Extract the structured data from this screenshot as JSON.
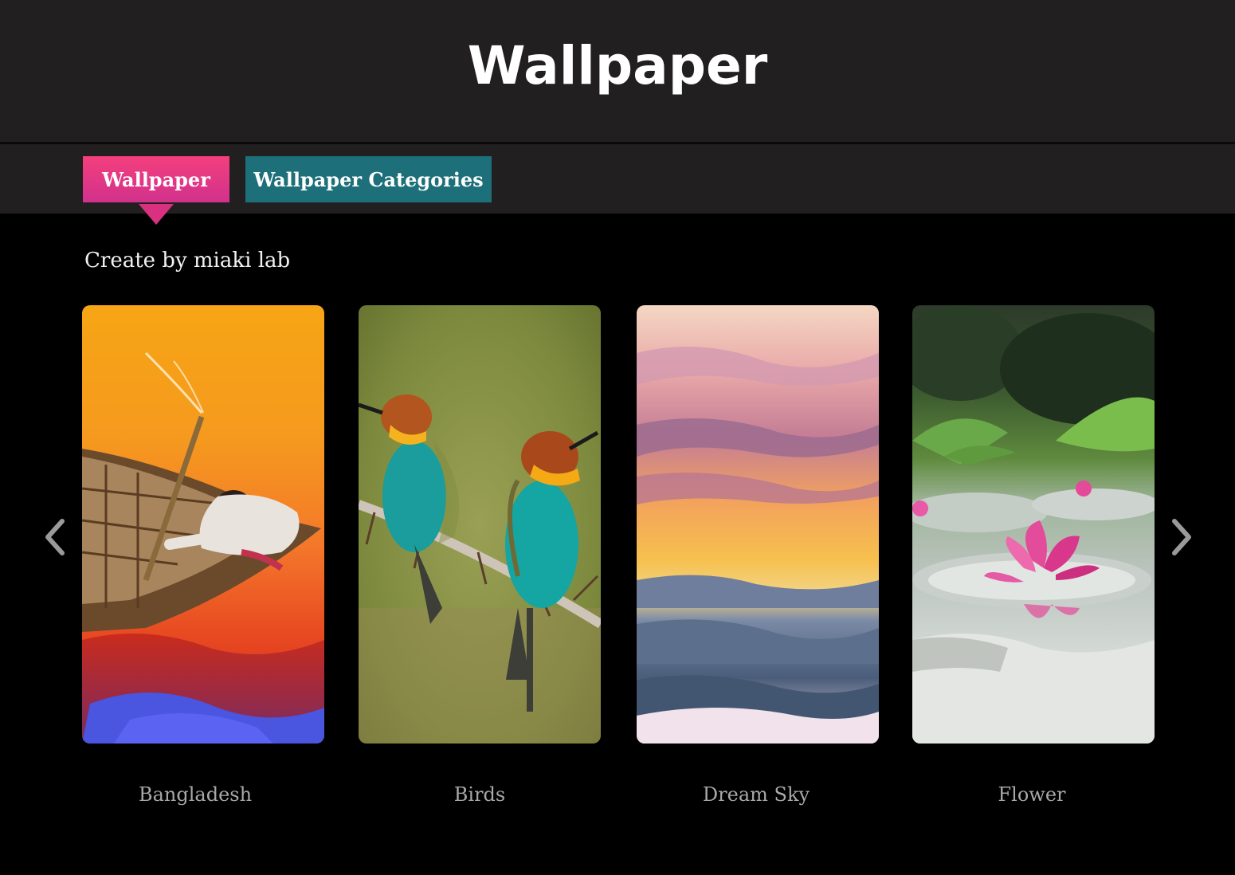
{
  "header": {
    "title": "Wallpaper"
  },
  "tabs": [
    {
      "label": "Wallpaper",
      "active": true,
      "color": "#e8357f"
    },
    {
      "label": "Wallpaper Categories",
      "active": false,
      "color": "#1d6f79"
    }
  ],
  "subtitle": "Create by miaki lab",
  "cards": [
    {
      "label": "Bangladesh",
      "image": "boatman-on-orange-sunset-river"
    },
    {
      "label": "Birds",
      "image": "two-bee-eater-birds-on-branch"
    },
    {
      "label": "Dream Sky",
      "image": "sunset-clouds-sky"
    },
    {
      "label": "Flower",
      "image": "pink-water-lily-pond"
    }
  ],
  "navigation": {
    "prev_icon": "chevron-left-icon",
    "next_icon": "chevron-right-icon"
  },
  "colors": {
    "header_bg": "#211f20",
    "page_bg": "#000000",
    "label_text": "#a8a8a8"
  }
}
